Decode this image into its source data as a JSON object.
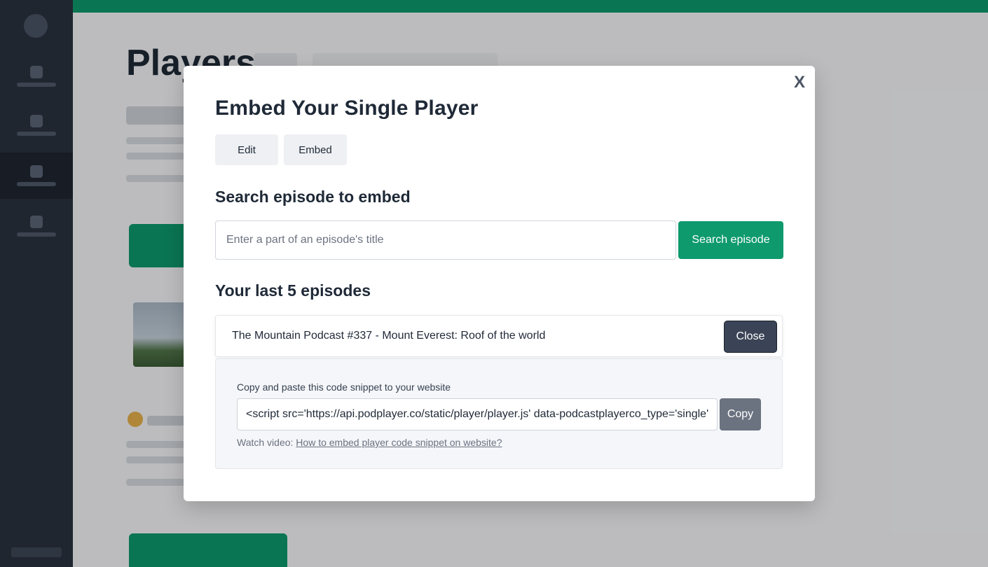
{
  "modal": {
    "close_label": "X",
    "title": "Embed Your Single Player",
    "tabs": [
      {
        "label": "Edit"
      },
      {
        "label": "Embed"
      }
    ],
    "search": {
      "heading": "Search episode to embed",
      "placeholder": "Enter a part of an episode's title",
      "button_label": "Search episode"
    },
    "last_episodes": {
      "heading": "Your last 5 episodes",
      "episode": {
        "title": "The Mountain Podcast #337 - Mount Everest: Roof of the world",
        "close_label": "Close"
      },
      "embed": {
        "instruction": "Copy and paste this code snippet to your website",
        "code_value": "<script src='https://api.podplayer.co/static/player/player.js' data-podcastplayerco_type='single'",
        "copy_label": "Copy",
        "watch_prefix": "Watch video:",
        "watch_link": "How to embed player code snippet on website?"
      }
    }
  },
  "background": {
    "page_title": "Players"
  },
  "colors": {
    "accent": "#0e9a6c",
    "sidebar": "#2b3340",
    "close_button": "#3a4456",
    "copy_button": "#6b7280"
  }
}
